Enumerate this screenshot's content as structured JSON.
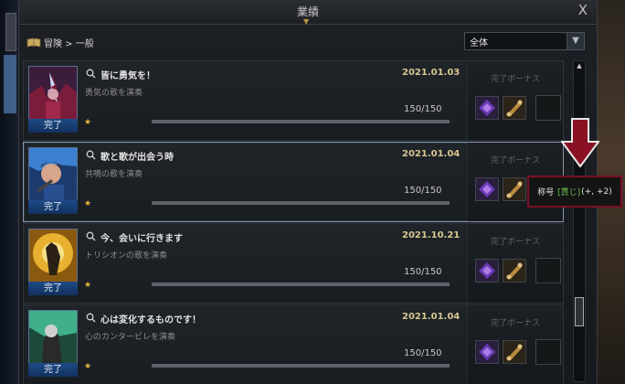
{
  "window": {
    "title": "業績",
    "close_label": "X"
  },
  "breadcrumb": {
    "text": "冒険 > 一般"
  },
  "filter": {
    "selected": "全体"
  },
  "entries": [
    {
      "title": "皆に勇気を！",
      "description": "勇気の歌を演奏",
      "date": "2021.01.03",
      "progress": "150/150",
      "progress_fraction": 1.0,
      "status": "完了",
      "bonus_label": "完了ボーナス",
      "stars": "★"
    },
    {
      "title": "歌と歌が出会う時",
      "description": "共鳴の歌を演奏",
      "date": "2021.01.04",
      "progress": "150/150",
      "progress_fraction": 1.0,
      "status": "完了",
      "bonus_label": "完了ボーナス",
      "stars": "★"
    },
    {
      "title": "今、会いに行きます",
      "description": "トリシオンの歌を演奏",
      "date": "2021.10.21",
      "progress": "150/150",
      "progress_fraction": 1.0,
      "status": "完了",
      "bonus_label": "完了ボーナス",
      "stars": "★"
    },
    {
      "title": "心は変化するものです！",
      "description": "心のカンタービレを演奏",
      "date": "2021.01.04",
      "progress": "150/150",
      "progress_fraction": 1.0,
      "status": "完了",
      "bonus_label": "完了ボーナス",
      "stars": "★"
    }
  ],
  "tooltip": {
    "prefix": "称号",
    "tag": "[貫じ]",
    "suffix": "(+, +2)"
  },
  "colors": {
    "accent_date": "#d8c690",
    "done_badge": "#1e4b86",
    "tooltip_border": "#7a1025",
    "arrow": "#8a1024"
  }
}
